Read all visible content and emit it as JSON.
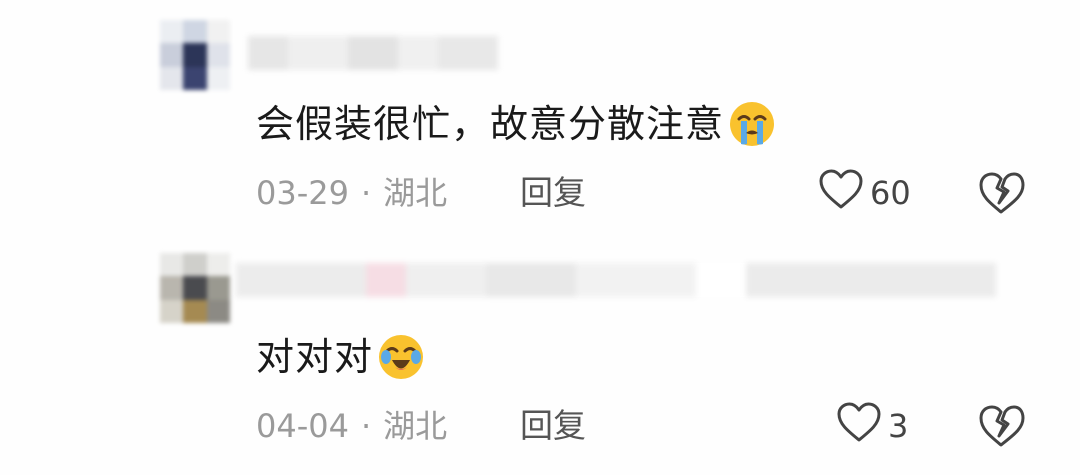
{
  "comments": [
    {
      "text": "会假装很忙，故意分散注意",
      "emoji_icon": "loudly-crying-face-icon",
      "date": "03-29",
      "separator": "·",
      "location": "湖北",
      "reply_label": "回复",
      "like_count": "60"
    },
    {
      "text": "对对对",
      "emoji_icon": "tears-of-joy-crying-face-icon",
      "date": "04-04",
      "separator": "·",
      "location": "湖北",
      "reply_label": "回复",
      "like_count": "3"
    }
  ],
  "colors": {
    "text": "#1a1a1a",
    "meta": "#9a9a9a",
    "action": "#555555",
    "emoji_yellow": "#f9c22e",
    "emoji_tear": "#5aa9e6"
  }
}
